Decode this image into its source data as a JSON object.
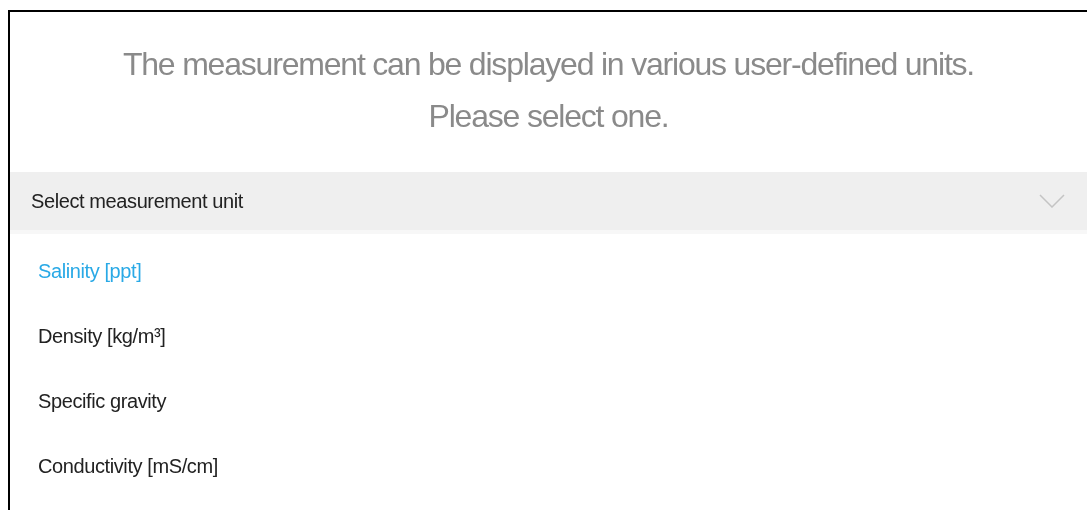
{
  "message": {
    "lines": [
      "The measurement can be displayed in various user-defined units.",
      "Please select one."
    ]
  },
  "dropdown": {
    "placeholder": "Select measurement unit",
    "expanded": true,
    "options": [
      {
        "label": "Salinity [ppt]",
        "selected": true
      },
      {
        "label": "Density [kg/m³]",
        "selected": false
      },
      {
        "label": "Specific gravity",
        "selected": false
      },
      {
        "label": "Conductivity [mS/cm]",
        "selected": false
      }
    ]
  }
}
